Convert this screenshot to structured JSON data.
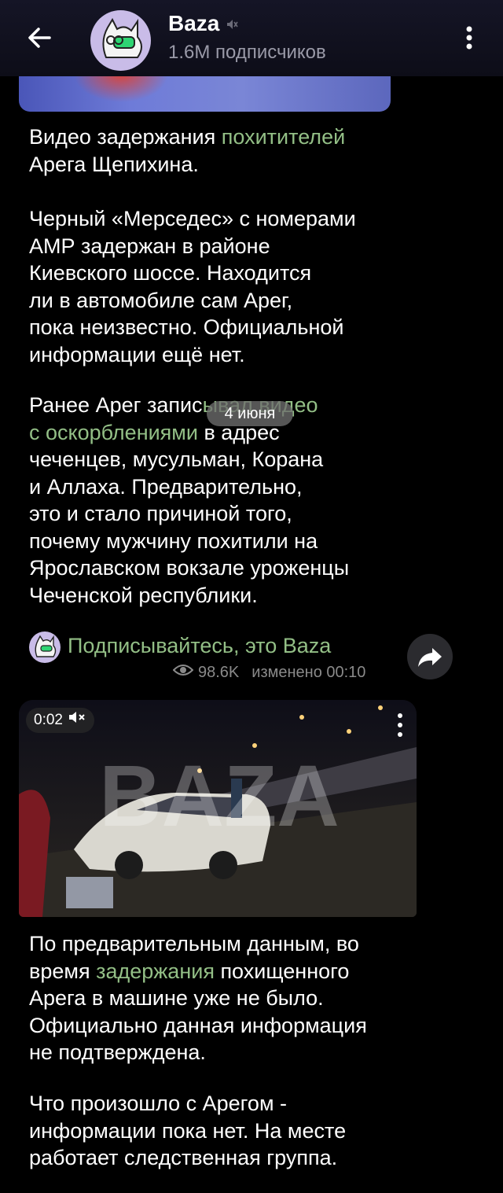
{
  "header": {
    "title": "Baza",
    "subscribers": "1.6M подписчиков"
  },
  "post1": {
    "p1_before": "Видео задержания ",
    "p1_link": "похитителей",
    "p1_after": "\nАрега Щепихина.",
    "p2": "Черный «Мерседес» с номерами\nАМР задержан в районе\nКиевского шоссе. Находится\nли в автомобиле сам Арег,\nпока неизвестно. Официальной\nинформации ещё нет.",
    "p3_before": "Ранее Арег запис",
    "p3_link": "ывал видео\nс оскорблениями",
    "p3_after": " в адрес\nчеченцев, мусульман, Корана\nи Аллаха. Предварительно,\nэто и стало причиной того,\nпочему мужчину похитили на\nЯрославском вокзале уроженцы\nЧеченской республики.",
    "signature": "Подписывайтесь, это Baza",
    "views": "98.6K",
    "edited": "изменено 00:10"
  },
  "date_separator": "4 июня",
  "video": {
    "duration": "0:02",
    "watermark": "BAZA"
  },
  "post2": {
    "p1_before": "По предварительным данным, во\nвремя ",
    "p1_link": "задержания",
    "p1_after": " похищенного\nАрега в машине уже не было.\nОфициально данная информация\nне подтверждена.",
    "p2": "Что произошло с Арегом -\nинформации пока нет. На месте\nработает следственная группа."
  },
  "colors": {
    "link": "#93bf86",
    "header_bg": "#151526",
    "meta": "#8a8a8a"
  }
}
